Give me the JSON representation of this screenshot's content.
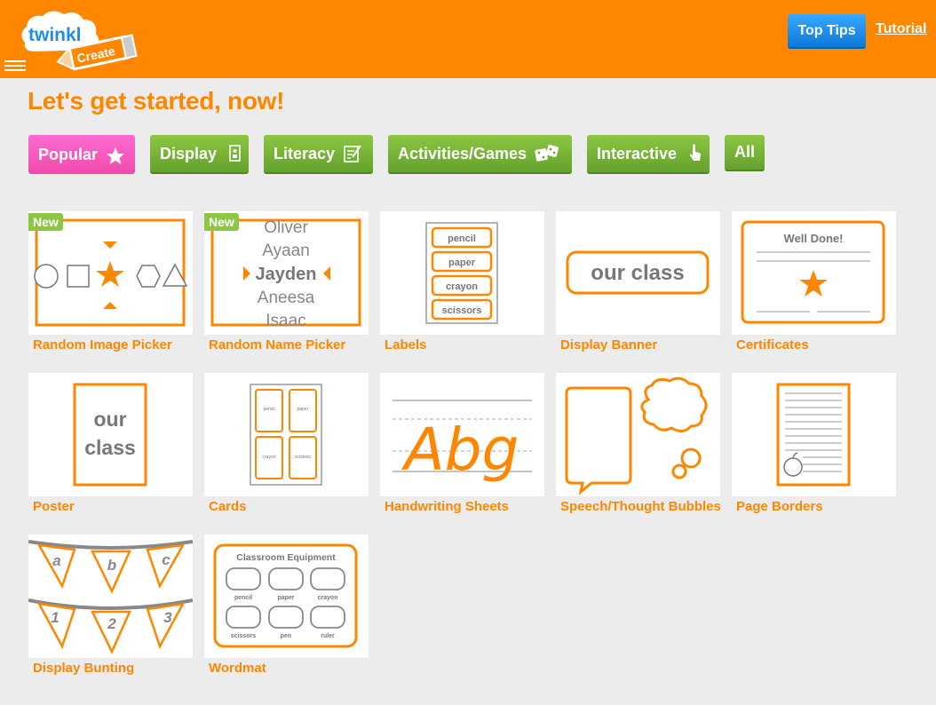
{
  "header": {
    "logo_text": "twinkl",
    "logo_subtext": "Create",
    "top_tips_label": "Top Tips",
    "tutorial_label": "Tutorial"
  },
  "page_title": "Let's get started, now!",
  "filters": [
    {
      "label": "Popular",
      "icon": "star-icon"
    },
    {
      "label": "Display",
      "icon": "poster-icon"
    },
    {
      "label": "Literacy",
      "icon": "writing-icon"
    },
    {
      "label": "Activities/Games",
      "icon": "dice-icon"
    },
    {
      "label": "Interactive",
      "icon": "pointer-hand-icon"
    },
    {
      "label": "All"
    }
  ],
  "colors": {
    "brand_orange": "#ff8700",
    "popular_pink": "#f04aaa",
    "filter_green": "#7ab33a",
    "button_blue": "#1e8ee8"
  },
  "badge_new": "New",
  "tiles": [
    {
      "label": "Random Image Picker",
      "new": true
    },
    {
      "label": "Random Name Picker",
      "new": true,
      "names": [
        "Oliver",
        "Ayaan",
        "Jayden",
        "Aneesa",
        "Isaac"
      ]
    },
    {
      "label": "Labels",
      "items": [
        "pencil",
        "paper",
        "crayon",
        "scissors"
      ]
    },
    {
      "label": "Display Banner",
      "text": "our class"
    },
    {
      "label": "Certificates",
      "text": "Well Done!"
    },
    {
      "label": "Poster",
      "text_line1": "our",
      "text_line2": "class"
    },
    {
      "label": "Cards",
      "items": [
        "pencil",
        "paper",
        "crayon",
        "scissors"
      ]
    },
    {
      "label": "Handwriting Sheets",
      "text": "Abg"
    },
    {
      "label": "Speech/Thought Bubbles"
    },
    {
      "label": "Page Borders"
    },
    {
      "label": "Display Bunting",
      "letters": [
        "a",
        "b",
        "c",
        "1",
        "2",
        "3"
      ]
    },
    {
      "label": "Wordmat",
      "heading": "Classroom Equipment",
      "items": [
        "pencil",
        "paper",
        "crayon",
        "scissors",
        "pen",
        "ruler"
      ]
    }
  ]
}
